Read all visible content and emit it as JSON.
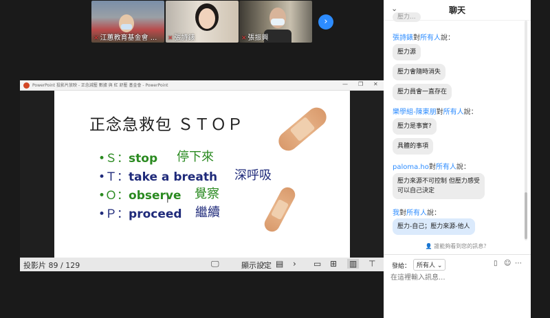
{
  "participants": [
    {
      "name": "江蕙教育基金會 ..."
    },
    {
      "name": "張詩錶"
    },
    {
      "name": "張振興"
    }
  ],
  "ppt_window": {
    "title": "PowerPoint 投影片放映 - 正念減壓 數據 與 紅 舒壓 基金會 - PowerPoint",
    "minimize": "—",
    "restore": "❐",
    "close": "✕"
  },
  "slide": {
    "title": "正念急救包 ＳＴＯＰ",
    "items": [
      {
        "letter": "•Ｓ：",
        "en": "stop",
        "zh": "停下來",
        "color": "green"
      },
      {
        "letter": "•Ｔ：",
        "en": "take a breath",
        "zh": "深呼吸",
        "color": "navy"
      },
      {
        "letter": "•Ｏ：",
        "en": "observe",
        "zh": "覺察",
        "color": "green"
      },
      {
        "letter": "•Ｐ：",
        "en": "proceed",
        "zh": "繼續",
        "color": "navy"
      }
    ]
  },
  "statusbar": {
    "slide_count": "投影片 89 / 129",
    "display_settings": "顯示設定"
  },
  "chat": {
    "title": "聊天",
    "messages": [
      {
        "sender": "張詩錶",
        "recipient": "所有人",
        "texts": [
          "壓力源",
          "壓力會隨時消失",
          "壓力員會一直存在"
        ]
      },
      {
        "sender": "樂學組-陳東朋",
        "recipient": "所有人",
        "texts": [
          "壓力是事實?",
          "具體的事項"
        ]
      },
      {
        "sender": "paloma.ho",
        "recipient": "所有人",
        "texts": [
          "壓力來源不可控制 但壓力感受\n可以自己決定"
        ]
      },
      {
        "sender": "我",
        "recipient": "所有人",
        "texts": [
          "壓力-自己；壓力來源-他人"
        ]
      }
    ],
    "said_suffix": "說：",
    "to_word": "對",
    "who_can_see": "誰能夠看到您的訊息？",
    "send_to_label": "發給：",
    "send_to_value": "所有人",
    "input_placeholder": "在這裡輸入訊息..."
  },
  "colors": {
    "accent": "#2d8cff",
    "slide_green": "#2a8a20",
    "slide_navy": "#1f2a7a"
  }
}
